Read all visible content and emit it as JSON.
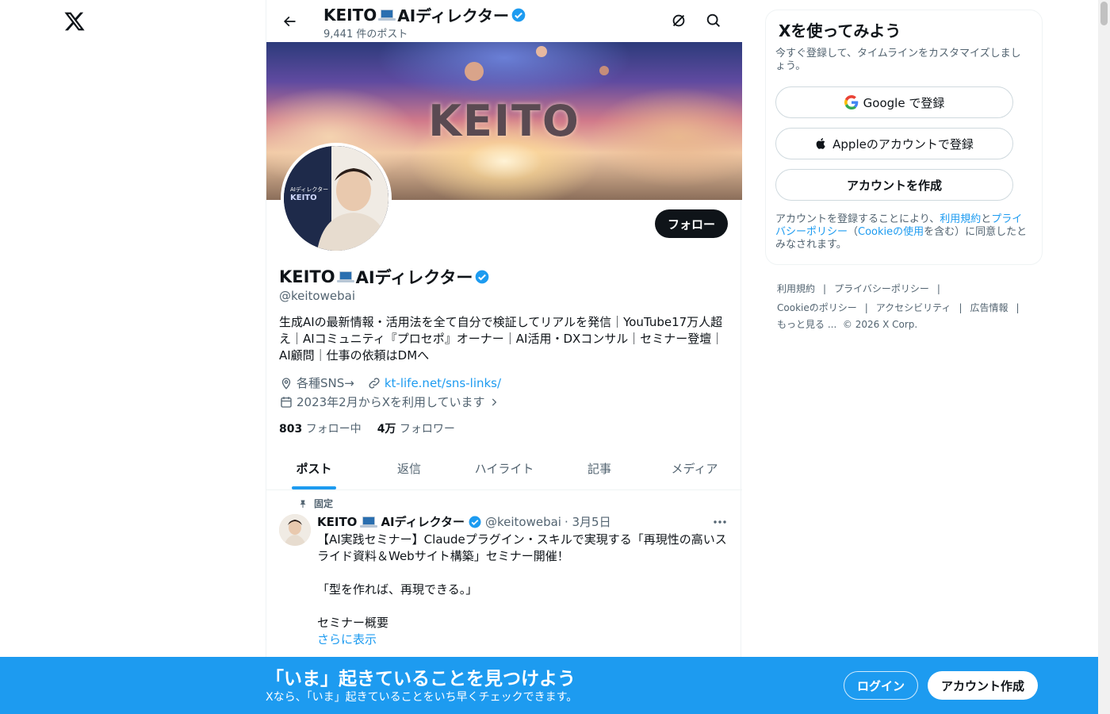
{
  "colors": {
    "accent": "#1d9bf0",
    "text": "#0f1419",
    "muted": "#536471",
    "bottom_bar": "#1d9bf0"
  },
  "nav": {
    "logo_icon": "x-logo-icon"
  },
  "header": {
    "name": "KEITO💻AIディレクター",
    "name_main": "KEITO",
    "name_suffix": "AIディレクター",
    "posts_count": "9,441 件のポスト",
    "back_icon": "arrow-left-icon",
    "search_icon": "search-icon",
    "grok_icon": "grok-icon"
  },
  "banner": {
    "text": "KEITO"
  },
  "profile": {
    "avatar_label_1": "AIディレクター",
    "avatar_label_2": "KEITO",
    "follow_label": "フォロー",
    "name_main": "KEITO",
    "name_suffix": "AIディレクター",
    "handle": "@keitowebai",
    "bio": "生成AIの最新情報・活用法を全て自分で検証してリアルを発信｜YouTube17万人超え｜AIコミュニティ『プロセポ』オーナー｜AI活用・DXコンサル｜セミナー登壇｜AI顧問｜仕事の依頼はDMへ",
    "location": "各種SNS→",
    "website": "kt-life.net/sns-links/",
    "joined": "2023年2月からXを利用しています",
    "following_count": "803",
    "following_label": "フォロー中",
    "followers_count": "4万",
    "followers_label": "フォロワー"
  },
  "tabs": [
    {
      "label": "ポスト",
      "active": true
    },
    {
      "label": "返信",
      "active": false
    },
    {
      "label": "ハイライト",
      "active": false
    },
    {
      "label": "記事",
      "active": false
    },
    {
      "label": "メディア",
      "active": false
    }
  ],
  "tweet": {
    "pinned_label": "固定",
    "name_main": "KEITO",
    "name_suffix": "AIディレクター",
    "handle": "@keitowebai",
    "date": "· 3月5日",
    "lines": [
      "【AI実践セミナー】Claudeプラグイン・スキルで実現する「再現性の高いスライド資料＆Webサイト構築」セミナー開催！",
      "",
      "「型を作れば、再現できる。」",
      "",
      "セミナー概要"
    ],
    "show_more": "さらに表示"
  },
  "signup": {
    "title": "Xを使ってみよう",
    "subtitle": "今すぐ登録して、タイムラインをカスタマイズしましょう。",
    "google_label": "Google で登録",
    "apple_label": "Appleのアカウントで登録",
    "create_label": "アカウントを作成",
    "terms_prefix": "アカウントを登録することにより、",
    "terms_link": "利用規約",
    "terms_and": "と",
    "privacy_link": "プライバシーポリシー",
    "terms_paren_open": "（",
    "cookie_link": "Cookieの使用",
    "terms_suffix": "を含む）に同意したとみなされます。"
  },
  "footer": {
    "links_row1": [
      "利用規約",
      "プライバシーポリシー"
    ],
    "links_row2": [
      "Cookieのポリシー",
      "アクセシビリティ",
      "広告情報"
    ],
    "more": "もっと見る ...",
    "copyright": "© 2026 X Corp."
  },
  "bottom_bar": {
    "title": "「いま」起きていることを見つけよう",
    "subtitle": "Xなら、「いま」起きていることをいち早くチェックできます。",
    "login_label": "ログイン",
    "signup_label": "アカウント作成"
  }
}
